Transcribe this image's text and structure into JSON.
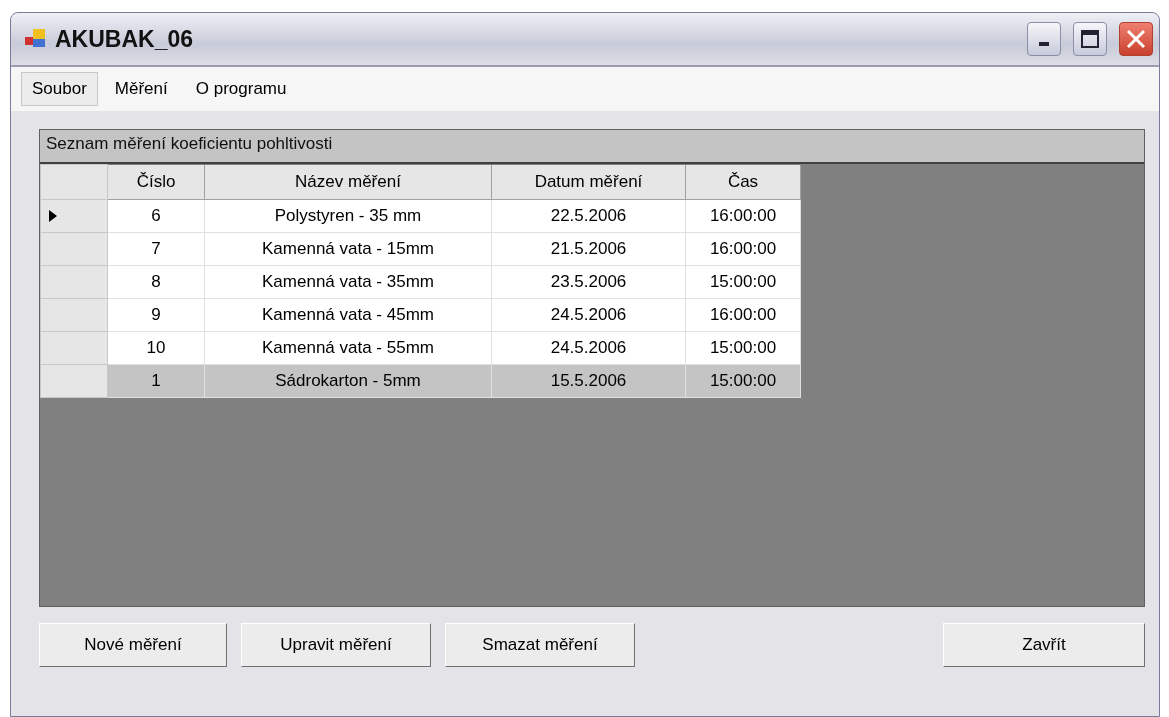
{
  "window": {
    "title": "AKUBAK_06"
  },
  "menu": [
    {
      "label": "Soubor",
      "selected": true
    },
    {
      "label": "Měření",
      "selected": false
    },
    {
      "label": "O programu",
      "selected": false
    }
  ],
  "table": {
    "caption": "Seznam měření koeficientu pohltivosti",
    "columns": [
      "Číslo",
      "Název měření",
      "Datum měření",
      "Čas"
    ],
    "rows": [
      {
        "current": true,
        "selected": false,
        "cells": [
          "6",
          "Polystyren - 35 mm",
          "22.5.2006",
          "16:00:00"
        ]
      },
      {
        "current": false,
        "selected": false,
        "cells": [
          "7",
          "Kamenná vata - 15mm",
          "21.5.2006",
          "16:00:00"
        ]
      },
      {
        "current": false,
        "selected": false,
        "cells": [
          "8",
          "Kamenná vata - 35mm",
          "23.5.2006",
          "15:00:00"
        ]
      },
      {
        "current": false,
        "selected": false,
        "cells": [
          "9",
          "Kamenná vata - 45mm",
          "24.5.2006",
          "16:00:00"
        ]
      },
      {
        "current": false,
        "selected": false,
        "cells": [
          "10",
          "Kamenná vata - 55mm",
          "24.5.2006",
          "15:00:00"
        ]
      },
      {
        "current": false,
        "selected": true,
        "cells": [
          "1",
          "Sádrokarton - 5mm",
          "15.5.2006",
          "15:00:00"
        ]
      }
    ]
  },
  "buttons": [
    "Nové měření",
    "Upravit měření",
    "Smazat měření"
  ],
  "close_button": "Zavřít"
}
